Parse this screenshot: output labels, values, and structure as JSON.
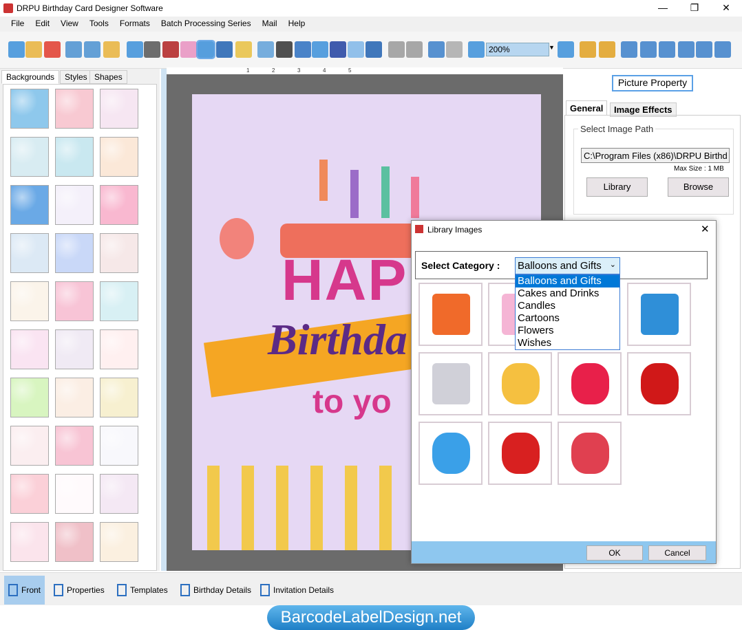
{
  "window": {
    "title": "DRPU Birthday Card Designer Software",
    "minimize": "—",
    "maximize": "❐",
    "close": "✕"
  },
  "menu": [
    "File",
    "Edit",
    "View",
    "Tools",
    "Formats",
    "Batch Processing Series",
    "Mail",
    "Help"
  ],
  "toolbar": {
    "zoom": "200%",
    "icons": [
      "new-icon",
      "open-icon",
      "close-icon",
      "save-icon",
      "save-as-icon",
      "export-icon",
      "properties-icon",
      "print-icon",
      "layers-icon",
      "gift-icon",
      "insert-picture-icon",
      "pen-icon",
      "shapes-icon",
      "wordart-icon",
      "barcode-icon",
      "text-icon",
      "text-box-icon",
      "signature-icon",
      "mail-icon",
      "line-icon",
      "database-icon",
      "database2-icon",
      "undo-icon",
      "redo-icon",
      "zoom-in-icon",
      "zoom-out-icon",
      "lock-icon",
      "unlock-icon",
      "arrow-left-icon",
      "flip-icon",
      "arrow-right-icon",
      "arrow-up-icon",
      "align-icon",
      "arrow-down-icon"
    ]
  },
  "left_tabs": [
    "Backgrounds",
    "Styles",
    "Shapes"
  ],
  "thumb_colors": [
    "#8ec8ec",
    "#f8c9d2",
    "#f6e6f2",
    "#d8ecf2",
    "#c9e8f0",
    "#fbe8d8",
    "#6aa9e6",
    "#f4f0fa",
    "#f9b8d0",
    "#dce9f5",
    "#c9d8f8",
    "#f6e8e8",
    "#fbf4ea",
    "#f8c4d6",
    "#d8f0f4",
    "#fae4f2",
    "#f0eaf4",
    "#fff0f0",
    "#d8f5c0",
    "#fbeee4",
    "#f7f0d0",
    "#fbeef0",
    "#f8c4d4",
    "#f8f8fc",
    "#fbd0d8",
    "#fffafc",
    "#f4e8f4",
    "#fbe4ec",
    "#f0c0c8",
    "#fbf0e0"
  ],
  "ruler": [
    "1",
    "2",
    "3",
    "4",
    "5"
  ],
  "card": {
    "line1": "HAPP",
    "line2": "Birthda",
    "line3": "to yo"
  },
  "right": {
    "title": "Picture Property",
    "tabs": [
      "General",
      "Image Effects"
    ],
    "group": "Select Image Path",
    "path": "C:\\Program Files (x86)\\DRPU Birthd",
    "max_size": "Max Size : 1 MB",
    "library": "Library",
    "browse": "Browse"
  },
  "dialog": {
    "title": "Library Images",
    "close": "✕",
    "category_label": "Select Category :",
    "selected": "Balloons and Gifts",
    "options": [
      "Balloons and Gifts",
      "Cakes and Drinks",
      "Candles",
      "Cartoons",
      "Flowers",
      "Wishes"
    ],
    "images": [
      "gift-box",
      "balloons-swirl",
      "gift-heart-box",
      "pink-gift",
      "balloons-card",
      "heart-balloons",
      "red-balloons",
      "colorful-balloons",
      "red-gift",
      "gift-pile"
    ],
    "ok": "OK",
    "cancel": "Cancel"
  },
  "bottom": [
    "Front",
    "Properties",
    "Templates",
    "Birthday Details",
    "Invitation Details"
  ],
  "watermark": "BarcodeLabelDesign.net"
}
